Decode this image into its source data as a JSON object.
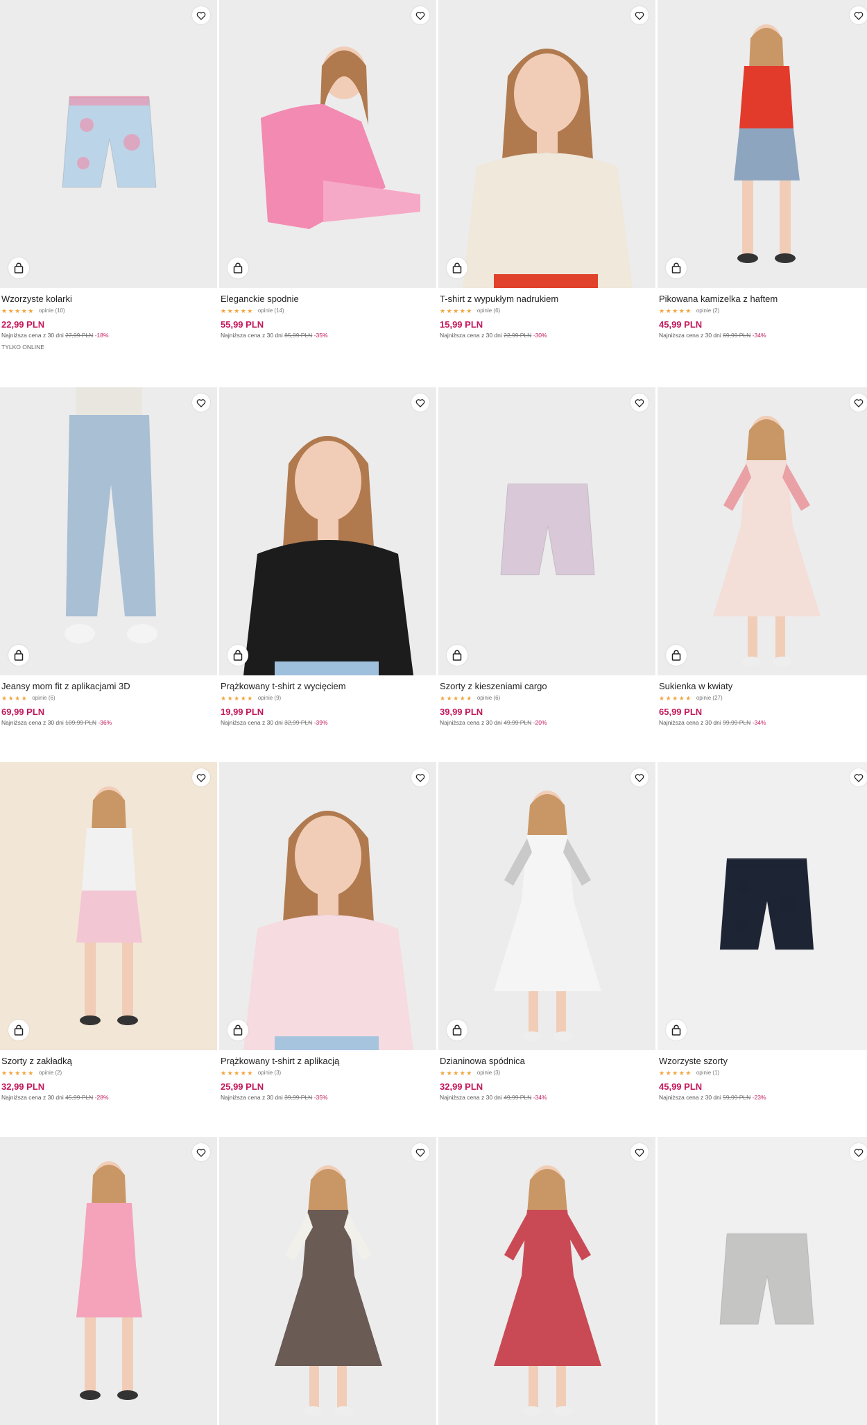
{
  "colors": {
    "price": "#c2185b",
    "stars": "#f2a23a",
    "card_bg": "#ececec"
  },
  "icons": {
    "favorite": "heart-icon",
    "cart": "shopping-bag-icon"
  },
  "lowest_label": "Najniższa cena z 30 dni",
  "products": [
    {
      "name": "Wzorzyste kolarki",
      "rating_stars": "★★★★★",
      "reviews": "opinie (10)",
      "price": "22,99 PLN",
      "old_price": "27,99 PLN",
      "discount": "-18%",
      "badge": "TYLKO ONLINE",
      "figure": "shorts",
      "colors": [
        "#bcd4e8",
        "#f28aa6"
      ]
    },
    {
      "name": "Eleganckie spodnie",
      "rating_stars": "★★★★★",
      "reviews": "opinie (14)",
      "price": "55,99 PLN",
      "old_price": "85,99 PLN",
      "discount": "-35%",
      "figure": "sit",
      "colors": [
        "#f28ab2",
        "#f6a9c6"
      ]
    },
    {
      "name": "T-shirt z wypukłym nadrukiem",
      "rating_stars": "★★★★★",
      "reviews": "opinie (6)",
      "price": "15,99 PLN",
      "old_price": "22,99 PLN",
      "discount": "-30%",
      "figure": "portrait",
      "colors": [
        "#efe8db",
        "#e0422b"
      ]
    },
    {
      "name": "Pikowana kamizelka z haftem",
      "rating_stars": "★★★★★",
      "reviews": "opinie (2)",
      "price": "45,99 PLN",
      "old_price": "69,99 PLN",
      "discount": "-34%",
      "figure": "stand",
      "colors": [
        "#e23b2c",
        "#8ea5bf"
      ]
    },
    {
      "name": "Jeansy mom fit z aplikacjami 3D",
      "rating_stars": "★★★★",
      "reviews": "opinie (6)",
      "price": "69,99 PLN",
      "old_price": "109,99 PLN",
      "discount": "-36%",
      "figure": "legs",
      "colors": [
        "#e9e6df",
        "#a8bfd4"
      ]
    },
    {
      "name": "Prążkowany t-shirt z wycięciem",
      "rating_stars": "★★★★★",
      "reviews": "opinie (9)",
      "price": "19,99 PLN",
      "old_price": "32,99 PLN",
      "discount": "-39%",
      "figure": "portrait",
      "colors": [
        "#1c1c1c",
        "#9fc0dc"
      ]
    },
    {
      "name": "Szorty z kieszeniami cargo",
      "rating_stars": "★★★★★",
      "reviews": "opinie (6)",
      "price": "39,99 PLN",
      "old_price": "49,99 PLN",
      "discount": "-20%",
      "figure": "shorts",
      "colors": [
        "#d9c8d8",
        "#d9c8d8"
      ]
    },
    {
      "name": "Sukienka w kwiaty",
      "rating_stars": "★★★★★",
      "reviews": "opinie (27)",
      "price": "65,99 PLN",
      "old_price": "99,99 PLN",
      "discount": "-34%",
      "figure": "dress",
      "colors": [
        "#f3ded8",
        "#e9a1a6"
      ]
    },
    {
      "name": "Szorty z zakładką",
      "rating_stars": "★★★★★",
      "reviews": "opinie (2)",
      "price": "32,99 PLN",
      "old_price": "45,99 PLN",
      "discount": "-28%",
      "figure": "stand",
      "colors": [
        "#f1f1f1",
        "#f3c6d3"
      ],
      "warm": true
    },
    {
      "name": "Prążkowany t-shirt z aplikacją",
      "rating_stars": "★★★★★",
      "reviews": "opinie (3)",
      "price": "25,99 PLN",
      "old_price": "39,99 PLN",
      "discount": "-35%",
      "figure": "portrait",
      "colors": [
        "#f6dbe0",
        "#a7c4df"
      ]
    },
    {
      "name": "Dzianinowa spódnica",
      "rating_stars": "★★★★★",
      "reviews": "opinie (3)",
      "price": "32,99 PLN",
      "old_price": "49,99 PLN",
      "discount": "-34%",
      "figure": "dress",
      "colors": [
        "#f5f5f5",
        "#c9c9c9"
      ]
    },
    {
      "name": "Wzorzyste szorty",
      "rating_stars": "★★★★★",
      "reviews": "opinie (1)",
      "price": "45,99 PLN",
      "old_price": "59,99 PLN",
      "discount": "-23%",
      "figure": "shorts",
      "colors": [
        "#1d2433",
        "#1d2433"
      ],
      "pale": true
    },
    {
      "figure": "stand",
      "colors": [
        "#f4a3bb",
        "#f4a3bb"
      ]
    },
    {
      "figure": "dress",
      "colors": [
        "#6b5b55",
        "#f2f0ea"
      ]
    },
    {
      "figure": "dress",
      "colors": [
        "#c94a55",
        "#c94a55"
      ]
    },
    {
      "figure": "shorts",
      "colors": [
        "#c5c6c4",
        "#c5c6c4"
      ],
      "pale": true
    }
  ]
}
